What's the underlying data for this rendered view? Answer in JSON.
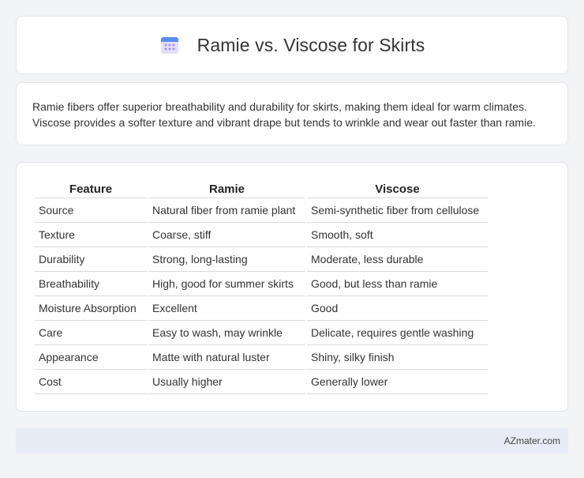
{
  "header": {
    "title": "Ramie vs. Viscose for Skirts",
    "icon": "calendar-icon"
  },
  "description": "Ramie fibers offer superior breathability and durability for skirts, making them ideal for warm climates. Viscose provides a softer texture and vibrant drape but tends to wrinkle and wear out faster than ramie.",
  "table": {
    "headers": [
      "Feature",
      "Ramie",
      "Viscose"
    ],
    "rows": [
      [
        "Source",
        "Natural fiber from ramie plant",
        "Semi-synthetic fiber from cellulose"
      ],
      [
        "Texture",
        "Coarse, stiff",
        "Smooth, soft"
      ],
      [
        "Durability",
        "Strong, long-lasting",
        "Moderate, less durable"
      ],
      [
        "Breathability",
        "High, good for summer skirts",
        "Good, but less than ramie"
      ],
      [
        "Moisture Absorption",
        "Excellent",
        "Good"
      ],
      [
        "Care",
        "Easy to wash, may wrinkle",
        "Delicate, requires gentle washing"
      ],
      [
        "Appearance",
        "Matte with natural luster",
        "Shiny, silky finish"
      ],
      [
        "Cost",
        "Usually higher",
        "Generally lower"
      ]
    ]
  },
  "footer": {
    "brand": "AZmater.com"
  }
}
